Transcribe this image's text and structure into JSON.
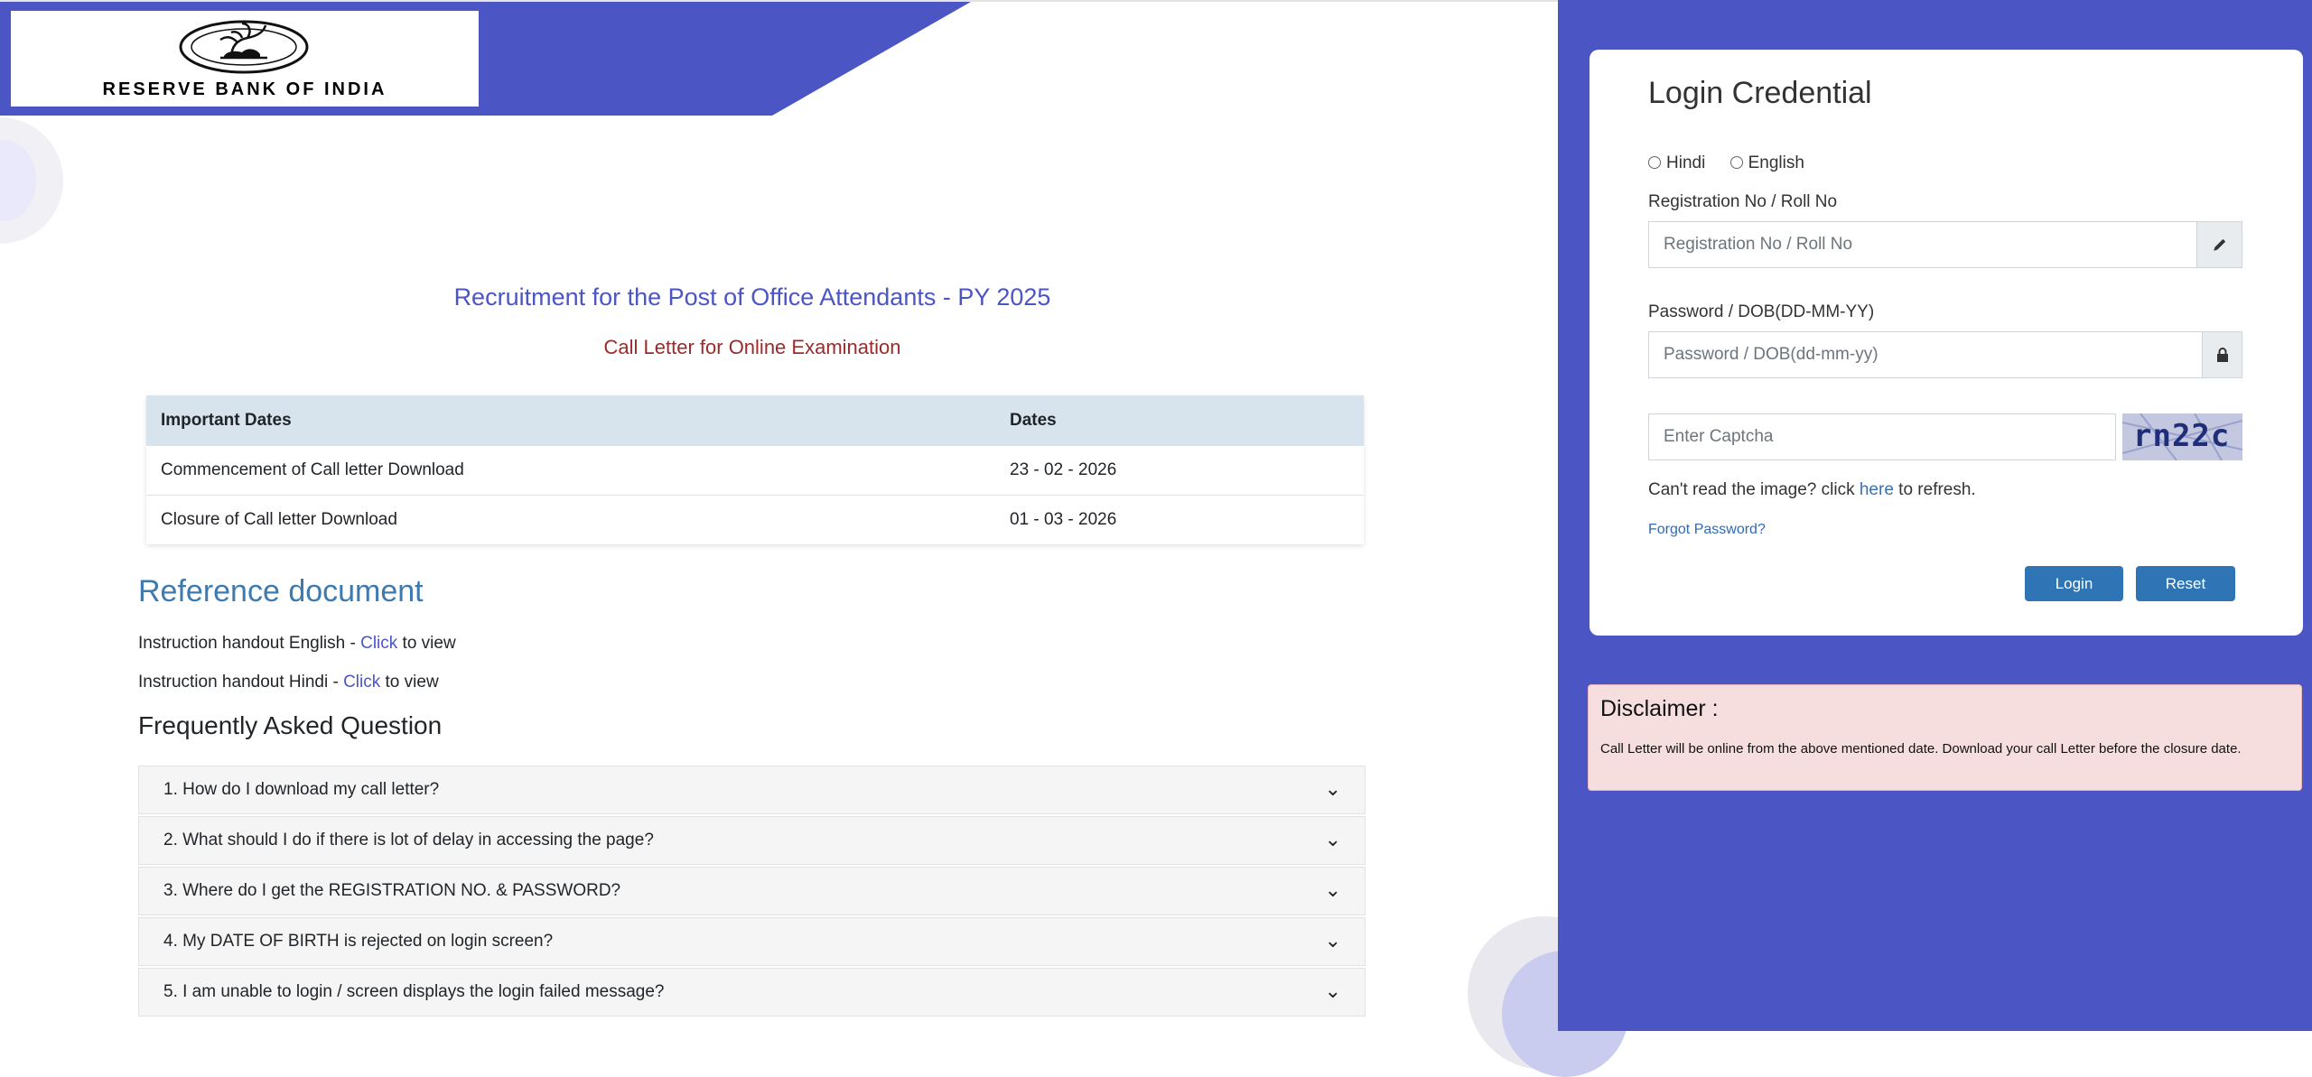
{
  "header": {
    "logo_text": "RESERVE BANK OF INDIA"
  },
  "page": {
    "title": "Recruitment for the Post of Office Attendants - PY 2025",
    "subtitle": "Call Letter for Online Examination"
  },
  "dates_table": {
    "headers": [
      "Important Dates",
      "Dates"
    ],
    "rows": [
      [
        "Commencement of Call letter Download",
        "23 - 02 - 2026"
      ],
      [
        "Closure of Call letter Download",
        "01 - 03 - 2026"
      ]
    ]
  },
  "reference": {
    "heading": "Reference document",
    "items": [
      {
        "prefix": "Instruction handout English - ",
        "link": "Click",
        "suffix": " to view"
      },
      {
        "prefix": "Instruction handout Hindi - ",
        "link": "Click",
        "suffix": " to view"
      }
    ]
  },
  "faq": {
    "heading": "Frequently Asked Question",
    "items": [
      "1. How do I download my call letter?",
      "2. What should I do if there is lot of delay in accessing the page?",
      "3. Where do I get the REGISTRATION NO. & PASSWORD?",
      "4. My DATE OF BIRTH is rejected on login screen?",
      "5. I am unable to login / screen displays the login failed message?"
    ]
  },
  "login": {
    "title": "Login Credential",
    "languages": [
      "Hindi",
      "English"
    ],
    "reg_label": "Registration No / Roll No",
    "reg_placeholder": "Registration No / Roll No",
    "reg_icon": "pencil-icon",
    "pwd_label": "Password / DOB(DD-MM-YY)",
    "pwd_placeholder": "Password / DOB(dd-mm-yy)",
    "pwd_icon": "lock-icon",
    "captcha_placeholder": "Enter Captcha",
    "captcha_text": "rn22c",
    "refresh_prefix": "Can't read the image? click ",
    "refresh_link": "here",
    "refresh_suffix": " to refresh.",
    "forgot": "Forgot Password?",
    "login_button": "Login",
    "reset_button": "Reset"
  },
  "disclaimer": {
    "title": "Disclaimer :",
    "text": "Call Letter will be online from the above mentioned date. Download your call Letter before the closure date."
  },
  "colors": {
    "primary": "#4b55c4",
    "subtitle_red": "#9c2a2a",
    "link_blue": "#3a6fb4",
    "button_blue": "#2f75b5",
    "table_header": "#d7e3ed",
    "disclaimer_bg": "#f7dede"
  }
}
